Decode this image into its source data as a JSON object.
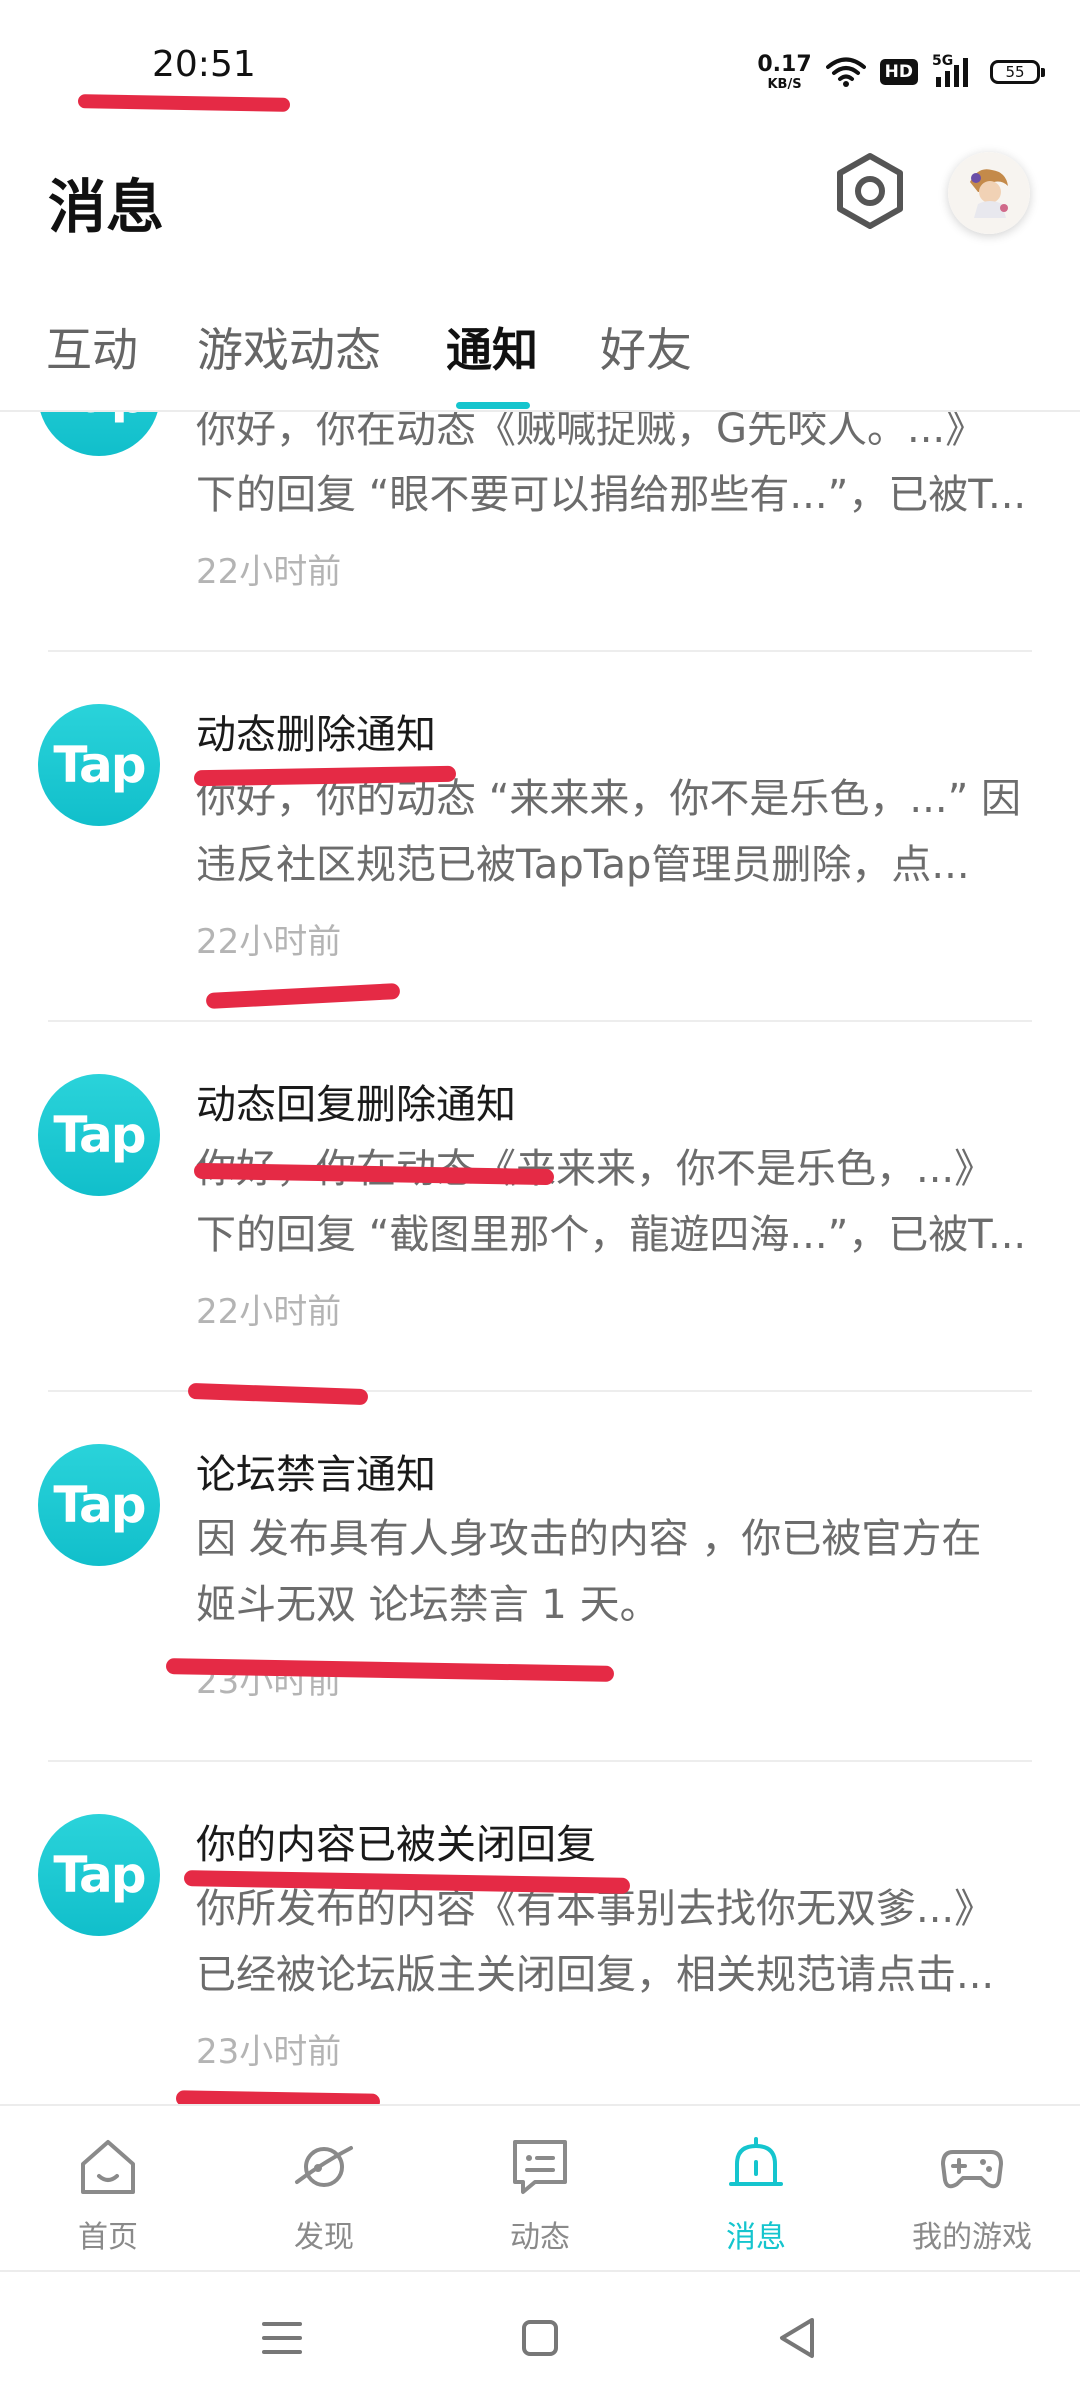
{
  "status_bar": {
    "time": "20:51",
    "net_speed_value": "0.17",
    "net_speed_unit": "KB/S",
    "hd_label": "HD",
    "network_label": "5G",
    "battery_level": "55",
    "icons": [
      "wifi-icon",
      "signal-icon",
      "battery-icon"
    ]
  },
  "header": {
    "title": "消息",
    "settings_icon": "gear-icon",
    "avatar_icon": "avatar"
  },
  "tabs": {
    "items": [
      {
        "label": "互动"
      },
      {
        "label": "游戏动态"
      },
      {
        "label": "通知"
      },
      {
        "label": "好友"
      }
    ],
    "active_index": 2
  },
  "notifications": [
    {
      "logo": "Tap",
      "title": "",
      "body_line1": "你好，你在动态《贼喊捉贼，G先咬人。...》",
      "body_line2": "下的回复 “眼不要可以捐给那些有...”，已被T...",
      "time": "22小时前"
    },
    {
      "logo": "Tap",
      "title": "动态删除通知",
      "body_line1": "你好，你的动态 “来来来，你不是乐色，...” 因",
      "body_line2": "违反社区规范已被TapTap管理员删除，点...",
      "time": "22小时前"
    },
    {
      "logo": "Tap",
      "title": "动态回复删除通知",
      "body_line1": "你好，你在动态《来来来，你不是乐色，...》",
      "body_line2": "下的回复 “截图里那个，龍遊四海...”，已被T...",
      "time": "22小时前"
    },
    {
      "logo": "Tap",
      "title": "论坛禁言通知",
      "body_line1": "因 发布具有人身攻击的内容 ，你已被官方在",
      "body_line2": "姬斗无双 论坛禁言 1 天。",
      "time": "23小时前"
    },
    {
      "logo": "Tap",
      "title": "你的内容已被关闭回复",
      "body_line1": "你所发布的内容《有本事别去找你无双爹...》",
      "body_line2": "已经被论坛版主关闭回复，相关规范请点击...",
      "time": "23小时前"
    }
  ],
  "bottom_nav": {
    "items": [
      {
        "label": "首页",
        "icon": "home-icon"
      },
      {
        "label": "发现",
        "icon": "planet-icon"
      },
      {
        "label": "动态",
        "icon": "chat-icon"
      },
      {
        "label": "消息",
        "icon": "bell-icon"
      },
      {
        "label": "我的游戏",
        "icon": "gamepad-icon"
      }
    ],
    "active_index": 3
  },
  "system_nav": {
    "icons": [
      "menu-icon",
      "home-square-icon",
      "back-triangle-icon"
    ]
  },
  "colors": {
    "accent": "#15c5ce",
    "annotation_red": "#e52a45",
    "body_text": "#6c6c6c",
    "muted_text": "#b4b4b4"
  }
}
